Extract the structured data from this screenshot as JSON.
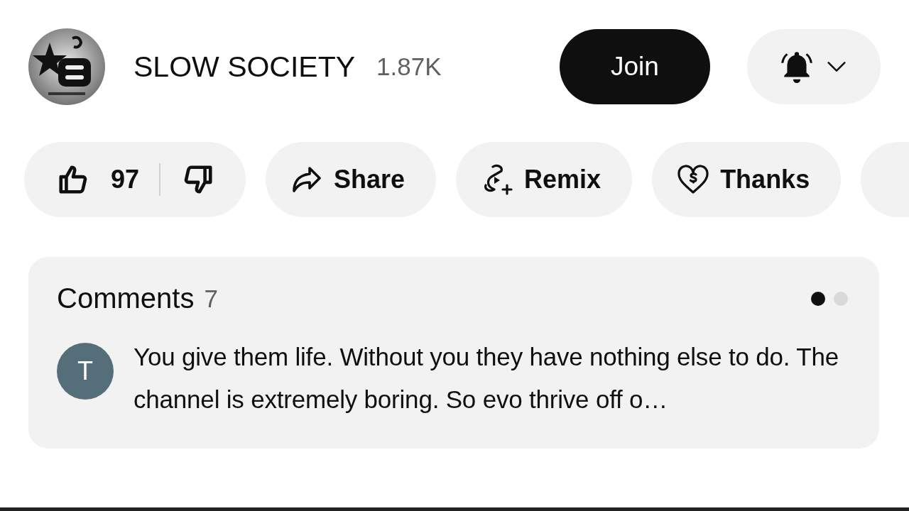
{
  "channel": {
    "name": "SLOW SOCIETY",
    "subscribers": "1.87K",
    "join_label": "Join"
  },
  "actions": [
    {
      "kind": "like",
      "count": "97"
    },
    {
      "kind": "share",
      "label": "Share"
    },
    {
      "kind": "remix",
      "label": "Remix"
    },
    {
      "kind": "thanks",
      "label": "Thanks"
    },
    {
      "kind": "more"
    }
  ],
  "comments": {
    "title": "Comments",
    "count": "7",
    "pages": [
      {
        "selected": true
      },
      {
        "selected": false
      }
    ],
    "top_comment": {
      "avatar_letter": "T",
      "color": "#546e7a",
      "text": "You give them life. Without you they have nothing else to do. The channel is extremely boring. So evo thrive off o…"
    }
  }
}
